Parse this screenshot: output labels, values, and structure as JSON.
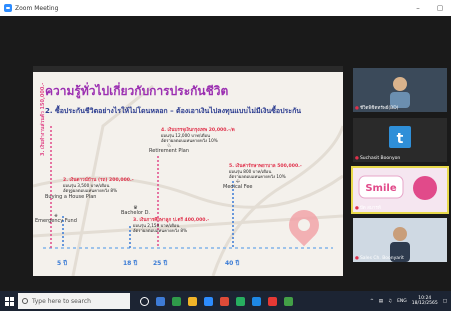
{
  "window": {
    "title": "Zoom Meeting",
    "controls": [
      "–",
      "▢"
    ]
  },
  "slide": {
    "title": "ความรู้ทั่วไปเกี่ยวกับการประกันชีวิต",
    "subtitle": "2. ซื้อประกันชีวิตอย่างไรให้ไม่โดนหลอก – ต้องเอาเงินไปลงทุนแบบไม่มีเงินซื้อประกัน",
    "vertical_label": "3. เงินทำงานส่วนตัว 150,000.-",
    "notes": [
      {
        "heading": "4. เงินบรรจุเงินกรุงเทพ 20,000.-/ด",
        "line1": "ผ่อนรุ่น 12,000 บาท/เดือน",
        "line2": "อัตราผลตอบแทนคาดหวัง 10%"
      },
      {
        "heading": "2. เงินดาวน์บ้าน (รถ) 200,000.-",
        "line1": "ผ่อนรุ่น 3,500 บาท/เดือน",
        "line2": "อัตราผลตอบแทนคาดหวัง 8%"
      },
      {
        "heading": "3. เงินการศึกษาลูก ป.ตรี 400,000.-",
        "line1": "ผ่อนรุ่น 2,150 บาท/เดือน",
        "line2": "อัตราผลตอบแทนคาดหวัง 8%"
      },
      {
        "heading": "5. เงินค่ารักษาพยาบาล 500,000.-",
        "line1": "ผ่อนรุ่น 800 บาท/เดือน",
        "line2": "อัตราผลตอบแทนคาดหวัง 10%"
      }
    ],
    "icon_labels": {
      "retirement": "Retirement Plan",
      "house": "Buying a House Plan",
      "emergency": "Emergency Fund",
      "medical": "Medical Fee",
      "education": "Bachelor D."
    },
    "ages": [
      "5 ปี",
      "18 ปี",
      "25 ปี",
      "40 ปี"
    ]
  },
  "participants": [
    {
      "name": "ชีวิตพิชิตทรัพย์(BD)",
      "color": "#6b8fb0"
    },
    {
      "name": "Suchasit Boonyon",
      "color": "#2f8fd8"
    },
    {
      "name": "บีต สมารท์",
      "color": "#f5e6f0"
    },
    {
      "name": "Sales Ch. Boonyarit",
      "color": "#cfd9e3"
    }
  ],
  "taskbar": {
    "search_placeholder": "Type here to search",
    "app_colors": [
      "#ffffff",
      "#3e7bd6",
      "#2f9b4a",
      "#f0b429",
      "#2d8cff",
      "#dd4b39",
      "#27ae60",
      "#1e88e5",
      "#e53935",
      "#43a047"
    ],
    "tray": {
      "lang": "ENG",
      "time": "10:24",
      "date": "18/12/2565"
    }
  }
}
